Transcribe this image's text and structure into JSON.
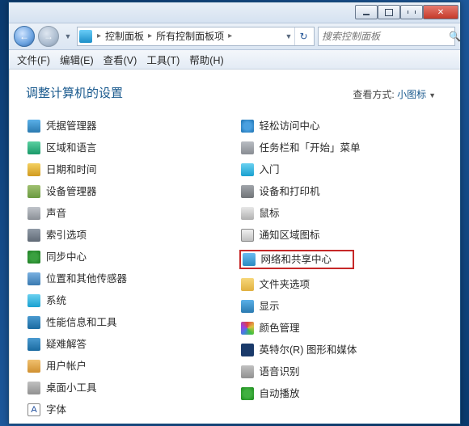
{
  "breadcrumbs": {
    "seg1": "控制面板",
    "seg2": "所有控制面板项"
  },
  "search": {
    "placeholder": "搜索控制面板"
  },
  "menu": {
    "file": "文件(F)",
    "edit": "编辑(E)",
    "view": "查看(V)",
    "tools": "工具(T)",
    "help": "帮助(H)"
  },
  "heading": "调整计算机的设置",
  "viewmode": {
    "label": "查看方式:",
    "value": "小图标"
  },
  "left": [
    {
      "icon": "i-cred",
      "name": "credential-manager",
      "label": "凭据管理器"
    },
    {
      "icon": "i-region",
      "name": "region-language",
      "label": "区域和语言"
    },
    {
      "icon": "i-date",
      "name": "date-time",
      "label": "日期和时间"
    },
    {
      "icon": "i-device",
      "name": "device-manager",
      "label": "设备管理器"
    },
    {
      "icon": "i-sound",
      "name": "sound",
      "label": "声音"
    },
    {
      "icon": "i-index",
      "name": "indexing-options",
      "label": "索引选项"
    },
    {
      "icon": "i-sync",
      "name": "sync-center",
      "label": "同步中心"
    },
    {
      "icon": "i-loc",
      "name": "location-sensors",
      "label": "位置和其他传感器"
    },
    {
      "icon": "i-sys",
      "name": "system",
      "label": "系统"
    },
    {
      "icon": "i-perf",
      "name": "performance-info",
      "label": "性能信息和工具"
    },
    {
      "icon": "i-trouble",
      "name": "troubleshooting",
      "label": "疑难解答"
    },
    {
      "icon": "i-user",
      "name": "user-accounts",
      "label": "用户帐户"
    },
    {
      "icon": "i-gadget",
      "name": "desktop-gadgets",
      "label": "桌面小工具"
    },
    {
      "icon": "i-font",
      "name": "fonts",
      "label": "字体",
      "glyph": "A"
    }
  ],
  "right": [
    {
      "icon": "i-ease",
      "name": "ease-of-access",
      "label": "轻松访问中心"
    },
    {
      "icon": "i-taskbar",
      "name": "taskbar-startmenu",
      "label": "任务栏和「开始」菜单"
    },
    {
      "icon": "i-start",
      "name": "getting-started",
      "label": "入门"
    },
    {
      "icon": "i-print",
      "name": "devices-printers",
      "label": "设备和打印机"
    },
    {
      "icon": "i-mouse",
      "name": "mouse",
      "label": "鼠标"
    },
    {
      "icon": "i-notif",
      "name": "notification-icons",
      "label": "通知区域图标"
    },
    {
      "icon": "i-net",
      "name": "network-sharing-center",
      "label": "网络和共享中心",
      "highlight": true
    },
    {
      "icon": "i-folder",
      "name": "folder-options",
      "label": "文件夹选项"
    },
    {
      "icon": "i-display",
      "name": "display",
      "label": "显示"
    },
    {
      "icon": "i-color",
      "name": "color-management",
      "label": "颜色管理"
    },
    {
      "icon": "i-intel",
      "name": "intel-graphics",
      "label": "英特尔(R) 图形和媒体"
    },
    {
      "icon": "i-speech",
      "name": "speech-recognition",
      "label": "语音识别"
    },
    {
      "icon": "i-autoplay",
      "name": "autoplay",
      "label": "自动播放"
    }
  ]
}
